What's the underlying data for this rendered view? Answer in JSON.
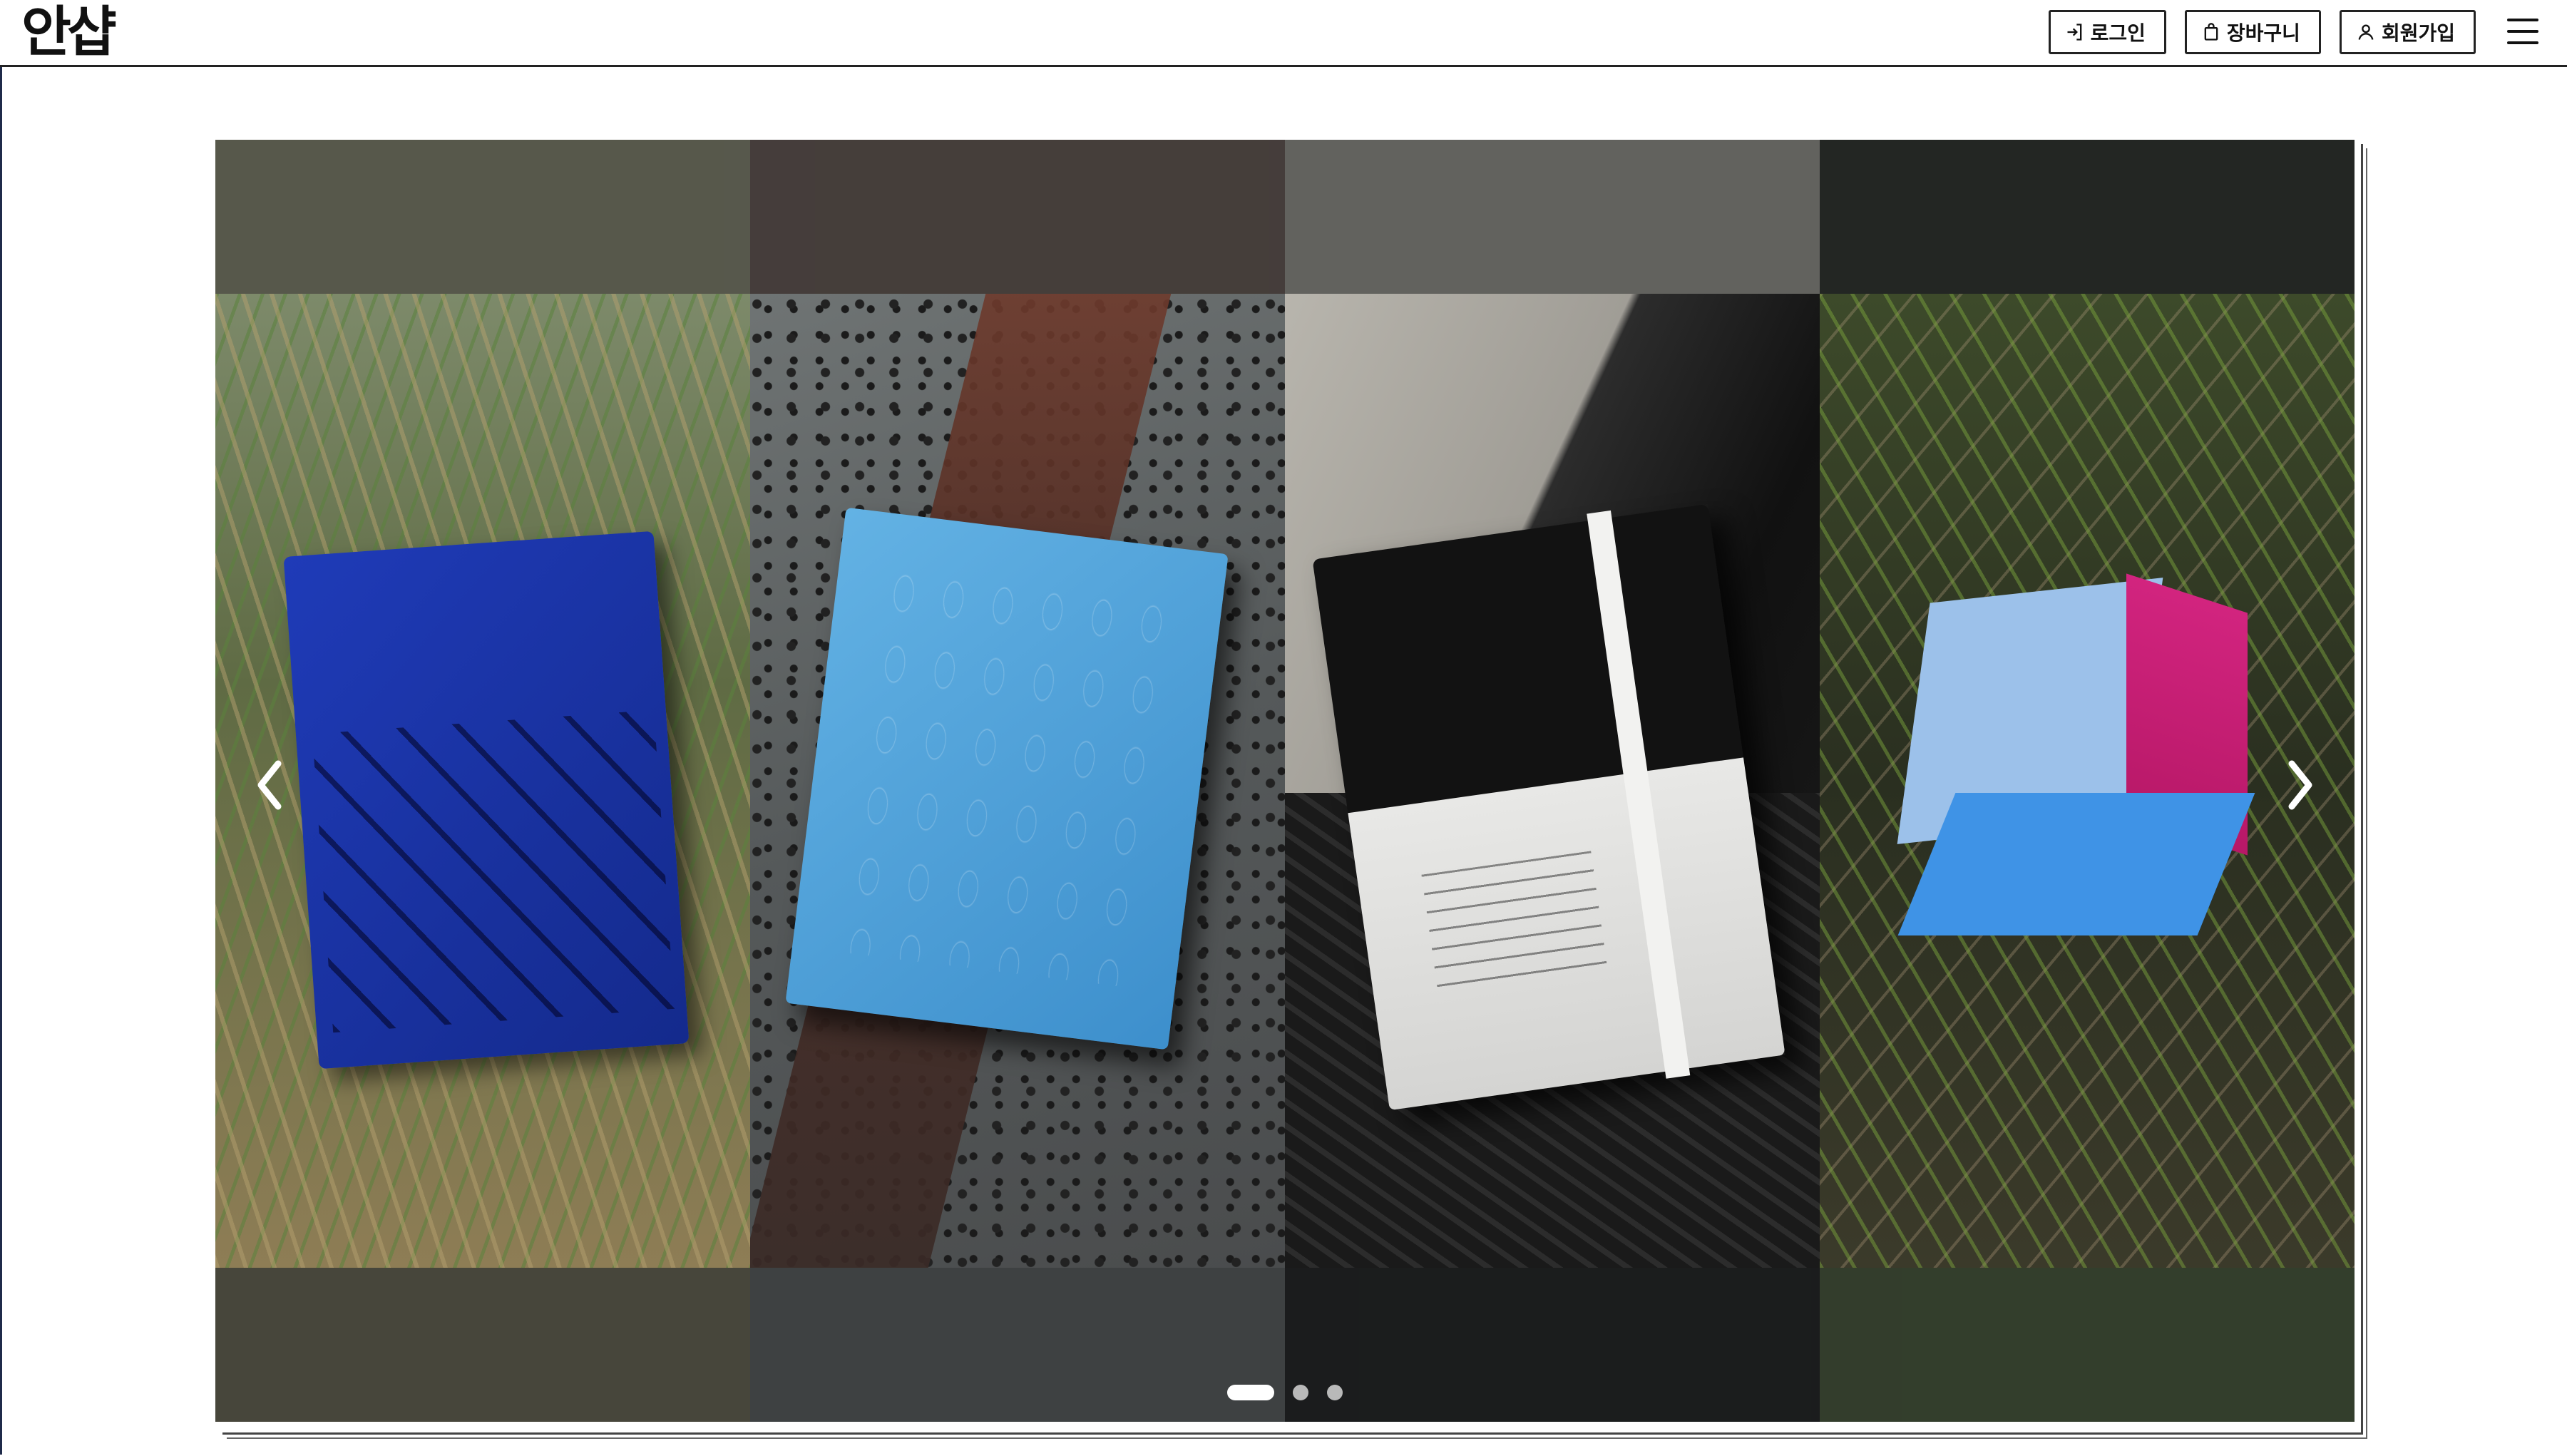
{
  "header": {
    "logo": "안샵",
    "buttons": [
      {
        "label": "로그인",
        "icon": "login-icon"
      },
      {
        "label": "장바구니",
        "icon": "shopping-bag-icon"
      },
      {
        "label": "회원가입",
        "icon": "user-icon"
      }
    ],
    "menu_icon": "hamburger-menu-icon"
  },
  "carousel": {
    "slides": [
      {
        "name": "navy-notebook-in-grass"
      },
      {
        "name": "light-blue-embossed-notebook-on-lava-stone"
      },
      {
        "name": "black-white-notebook-with-band"
      },
      {
        "name": "blue-pink-cube-on-forest-floor"
      }
    ],
    "prev_icon": "chevron-left-icon",
    "next_icon": "chevron-right-icon",
    "dot_count": 3,
    "active_dot": 0
  },
  "colors": {
    "accent_dark": "#111111",
    "frame_border": "#1f2a4a",
    "dot_active": "#ffffff",
    "dot_inactive": "#b9b9b9"
  }
}
